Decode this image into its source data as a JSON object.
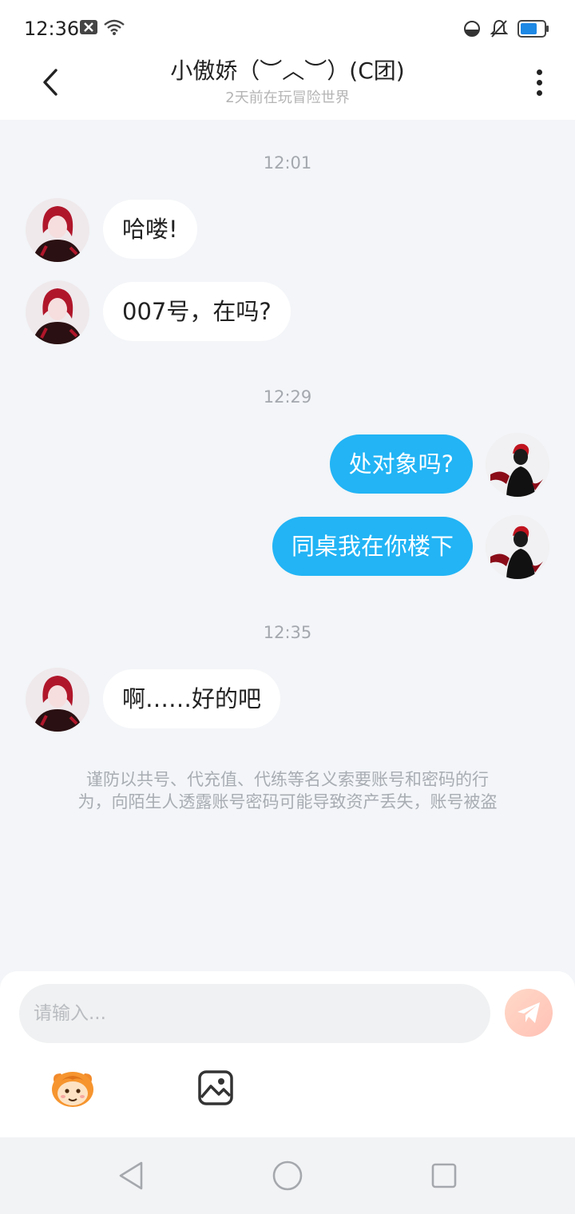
{
  "status_bar": {
    "time": "12:36"
  },
  "header": {
    "title": "小傲娇（︶︿︶）(C团)",
    "subtitle": "2天前在玩冒险世界"
  },
  "messages": [
    {
      "type": "time",
      "text": "12:01"
    },
    {
      "type": "msg",
      "side": "left",
      "text": "哈喽!"
    },
    {
      "type": "msg",
      "side": "left",
      "text": "007号，在吗?"
    },
    {
      "type": "time",
      "text": "12:29"
    },
    {
      "type": "msg",
      "side": "right",
      "text": "处对象吗?"
    },
    {
      "type": "msg",
      "side": "right",
      "text": "同桌我在你楼下"
    },
    {
      "type": "time",
      "text": "12:35"
    },
    {
      "type": "msg",
      "side": "left",
      "text": "啊……好的吧"
    }
  ],
  "warning": {
    "line1": "谨防以共号、代充值、代练等名义索要账号和密码的行",
    "line2": "为，向陌生人透露账号密码可能导致资产丢失，账号被盗"
  },
  "composer": {
    "placeholder": "请输入..."
  },
  "colors": {
    "outgoing_bubble": "#22b4f5",
    "incoming_bubble": "#ffffff",
    "chat_background": "#f3f5f8"
  },
  "icons": {
    "back": "chevron-left-icon",
    "more": "more-vertical-icon",
    "send": "paper-plane-icon",
    "emoji": "emoji-face-icon",
    "image": "image-icon"
  }
}
